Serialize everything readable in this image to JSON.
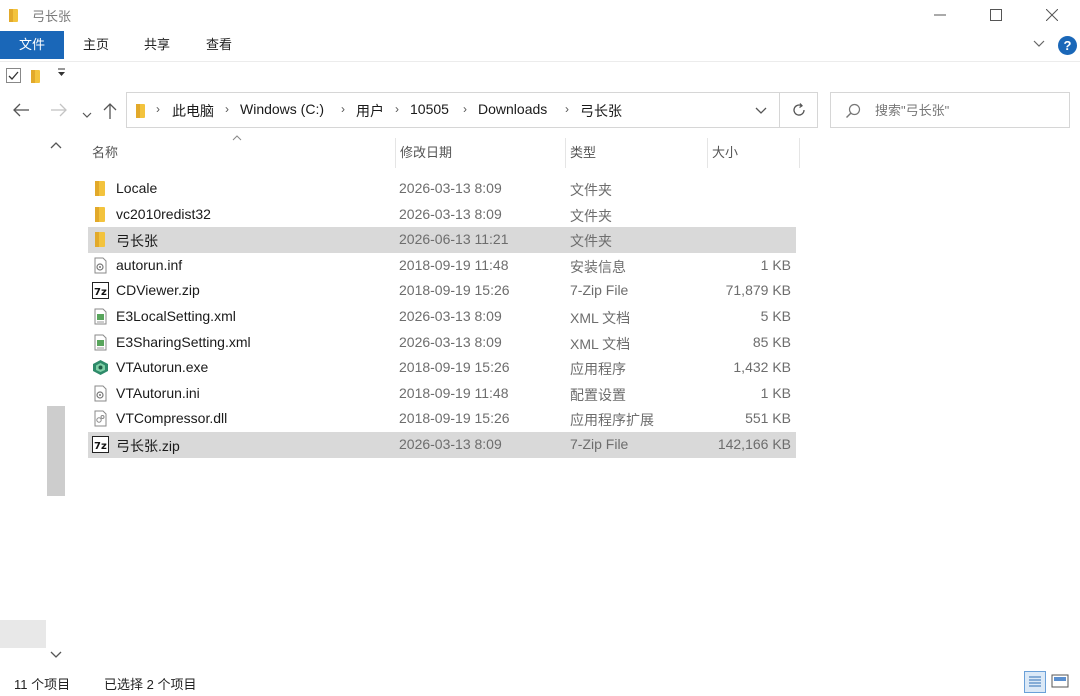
{
  "window": {
    "title": "弓长张"
  },
  "ribbon": {
    "tabs": [
      {
        "label": "文件"
      },
      {
        "label": "主页"
      },
      {
        "label": "共享"
      },
      {
        "label": "查看"
      }
    ]
  },
  "address": {
    "crumbs": [
      "此电脑",
      "Windows (C:)",
      "用户",
      "10505",
      "Downloads",
      "弓长张"
    ]
  },
  "search": {
    "placeholder": "搜索\"弓长张\""
  },
  "columns": {
    "name": "名称",
    "date": "修改日期",
    "type": "类型",
    "size": "大小"
  },
  "files": [
    {
      "name": "Locale",
      "date": "2026-03-13 8:09",
      "type": "文件夹",
      "size": "",
      "icon": "folder-icon",
      "selected": false
    },
    {
      "name": "vc2010redist32",
      "date": "2026-03-13 8:09",
      "type": "文件夹",
      "size": "",
      "icon": "folder-icon",
      "selected": false
    },
    {
      "name": "弓长张",
      "date": "2026-06-13 11:21",
      "type": "文件夹",
      "size": "",
      "icon": "folder-icon",
      "selected": true
    },
    {
      "name": "autorun.inf",
      "date": "2018-09-19 11:48",
      "type": "安装信息",
      "size": "1 KB",
      "icon": "settings-file-icon",
      "selected": false
    },
    {
      "name": "CDViewer.zip",
      "date": "2018-09-19 15:26",
      "type": "7-Zip File",
      "size": "71,879 KB",
      "icon": "7zip-icon",
      "selected": false
    },
    {
      "name": "E3LocalSetting.xml",
      "date": "2026-03-13 8:09",
      "type": "XML 文档",
      "size": "5 KB",
      "icon": "xml-file-icon",
      "selected": false
    },
    {
      "name": "E3SharingSetting.xml",
      "date": "2026-03-13 8:09",
      "type": "XML 文档",
      "size": "85 KB",
      "icon": "xml-file-icon",
      "selected": false
    },
    {
      "name": "VTAutorun.exe",
      "date": "2018-09-19 15:26",
      "type": "应用程序",
      "size": "1,432 KB",
      "icon": "exe-app-icon",
      "selected": false
    },
    {
      "name": "VTAutorun.ini",
      "date": "2018-09-19 11:48",
      "type": "配置设置",
      "size": "1 KB",
      "icon": "settings-file-icon",
      "selected": false
    },
    {
      "name": "VTCompressor.dll",
      "date": "2018-09-19 15:26",
      "type": "应用程序扩展",
      "size": "551 KB",
      "icon": "dll-file-icon",
      "selected": false
    },
    {
      "name": "弓长张.zip",
      "date": "2026-03-13 8:09",
      "type": "7-Zip File",
      "size": "142,166 KB",
      "icon": "7zip-icon",
      "selected": true
    }
  ],
  "status": {
    "count": "11 个项目",
    "selection": "已选择 2 个项目"
  },
  "colors": {
    "accent": "#1a67b8",
    "selected_row": "#d9d9d9",
    "folder": "#f3c33d"
  }
}
